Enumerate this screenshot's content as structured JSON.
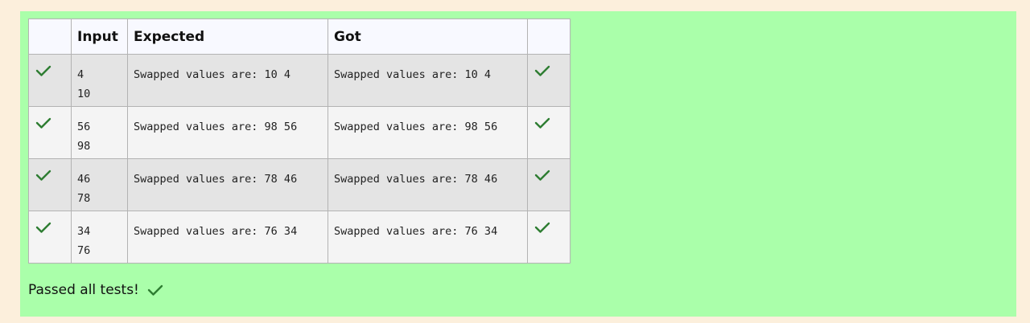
{
  "table": {
    "headers": [
      "",
      "Input",
      "Expected",
      "Got",
      ""
    ],
    "rows": [
      {
        "input": "4\n10",
        "expected": "Swapped values are: 10 4",
        "got": "Swapped values are: 10 4"
      },
      {
        "input": "56\n98",
        "expected": "Swapped values are: 98 56",
        "got": "Swapped values are: 98 56"
      },
      {
        "input": "46\n78",
        "expected": "Swapped values are: 78 46",
        "got": "Swapped values are: 78 46"
      },
      {
        "input": "34\n76",
        "expected": "Swapped values are: 76 34",
        "got": "Swapped values are: 76 34"
      }
    ]
  },
  "summary": {
    "text": "Passed all tests!",
    "icon": "check-icon"
  },
  "colors": {
    "page_background": "#fcefdc",
    "pass_background": "#aaffaa",
    "check": "#2e7d32"
  }
}
